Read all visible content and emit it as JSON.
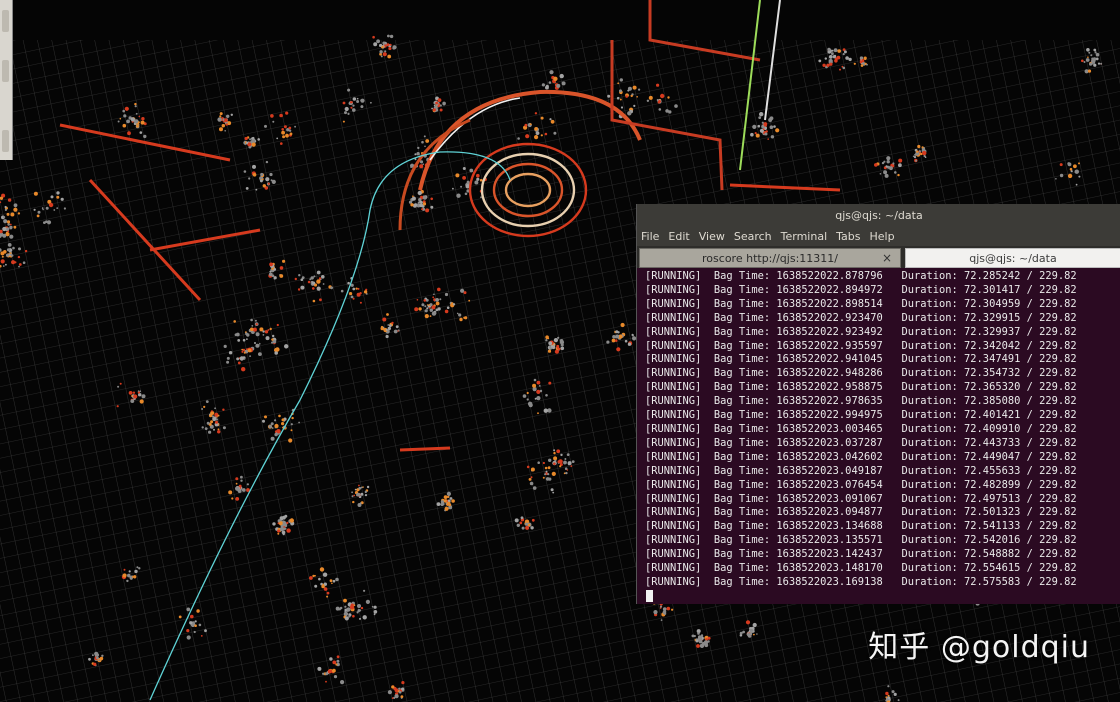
{
  "terminal": {
    "window_title": "qjs@qjs: ~/data",
    "menu": [
      "File",
      "Edit",
      "View",
      "Search",
      "Terminal",
      "Tabs",
      "Help"
    ],
    "tabs": [
      {
        "label": "roscore http://qjs:11311/",
        "close": "×"
      },
      {
        "label": "qjs@qjs: ~/data"
      }
    ],
    "lines": [
      "[RUNNING]  Bag Time: 1638522022.878796   Duration: 72.285242 / 229.82",
      "[RUNNING]  Bag Time: 1638522022.894972   Duration: 72.301417 / 229.82",
      "[RUNNING]  Bag Time: 1638522022.898514   Duration: 72.304959 / 229.82",
      "[RUNNING]  Bag Time: 1638522022.923470   Duration: 72.329915 / 229.82",
      "[RUNNING]  Bag Time: 1638522022.923492   Duration: 72.329937 / 229.82",
      "[RUNNING]  Bag Time: 1638522022.935597   Duration: 72.342042 / 229.82",
      "[RUNNING]  Bag Time: 1638522022.941045   Duration: 72.347491 / 229.82",
      "[RUNNING]  Bag Time: 1638522022.948286   Duration: 72.354732 / 229.82",
      "[RUNNING]  Bag Time: 1638522022.958875   Duration: 72.365320 / 229.82",
      "[RUNNING]  Bag Time: 1638522022.978635   Duration: 72.385080 / 229.82",
      "[RUNNING]  Bag Time: 1638522022.994975   Duration: 72.401421 / 229.82",
      "[RUNNING]  Bag Time: 1638522023.003465   Duration: 72.409910 / 229.82",
      "[RUNNING]  Bag Time: 1638522023.037287   Duration: 72.443733 / 229.82",
      "[RUNNING]  Bag Time: 1638522023.042602   Duration: 72.449047 / 229.82",
      "[RUNNING]  Bag Time: 1638522023.049187   Duration: 72.455633 / 229.82",
      "[RUNNING]  Bag Time: 1638522023.076454   Duration: 72.482899 / 229.82",
      "[RUNNING]  Bag Time: 1638522023.091067   Duration: 72.497513 / 229.82",
      "[RUNNING]  Bag Time: 1638522023.094877   Duration: 72.501323 / 229.82",
      "[RUNNING]  Bag Time: 1638522023.134688   Duration: 72.541133 / 229.82",
      "[RUNNING]  Bag Time: 1638522023.135571   Duration: 72.542016 / 229.82",
      "[RUNNING]  Bag Time: 1638522023.142437   Duration: 72.548882 / 229.82",
      "[RUNNING]  Bag Time: 1638522023.148170   Duration: 72.554615 / 229.82",
      "[RUNNING]  Bag Time: 1638522023.169138   Duration: 72.575583 / 229.82"
    ]
  },
  "watermark": "知乎 @goldqiu",
  "colors": {
    "terminal_bg": "#2b0a22",
    "pointcloud_gray": "#8a8a8a",
    "pointcloud_red": "#d63a1e",
    "pointcloud_orange": "#e8892a",
    "trajectory": "#5fd3d6",
    "grid": "#5a5a5a"
  }
}
